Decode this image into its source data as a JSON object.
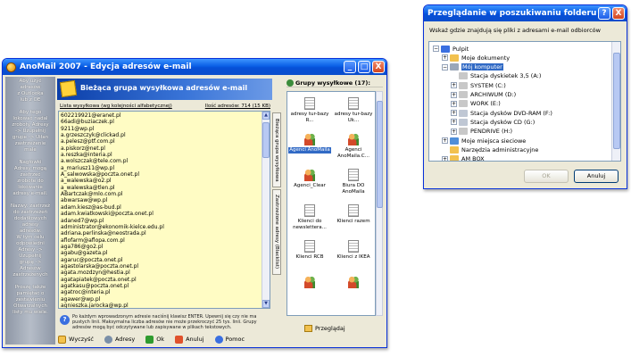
{
  "main_window": {
    "title": "AnoMail 2007 - Edycja adresów e-mail",
    "left_hint": "Aby użyć\nadresów\nz Outlooka\nlub z OE\n\nAby tego\nlokować nadal\nzroboty Adresy\n-> Uzupełnij\ngrupe -> Uiłan\nzastrzeżenie\nmale\n\nNagłówki\nAdresy mogą\nzastrzeć\nzrobote do\nlokowanie\nadresy e-mail.\n\nNazwy: zastrzeż\ndo zastrzeżeń\ndodatkowych\nadresy\nadresów.\nW tym celu\nodpowiedni\nAdresy ->\nUzupełnij\ngrupę ->\nAdresów\nzastrzeżenych\n\nProszę także\npamiętać o\nzestawieniu\nOtwarzalnych\nlisty mu wiele.",
    "header_title": "Bieżąca grupa wysyłkowa adresów e-mail",
    "list_label": "Lista wysyłkowa (wg kolejności alfabetycznej)",
    "count_label": "Ilość adresów: 714 (15 KB)",
    "emails": [
      "602219921@eranet.pl",
      "66adi@buziaczek.pl",
      "9211@wp.pl",
      "a.grzeszczyk@clickad.pl",
      "a.pelesz@ptf.com.pl",
      "a.piskorz@net.pl",
      "a.reszka@interia.pl",
      "a.wolszczak@tele.com.pl",
      "a_mariusz11@wp.pl",
      "A_salwowska@poczta.onet.pl",
      "a_walewska@o2.pl",
      "a_walewska@tlen.pl",
      "ABartczak@mlo.com.pl",
      "abwarsaw@wp.pl",
      "adam.kiesz@as-bud.pl",
      "adam.kwiatkowski@poczta.onet.pl",
      "adaned7@wp.pl",
      "administrator@ekonomik-kielce.edu.pl",
      "adriana.perlinska@neostrada.pl",
      "aflofarm@aflopa.com.pl",
      "aga786@go2.pl",
      "agabu@gazeta.pl",
      "agaruc@poczta.onet.pl",
      "agastolarska@poczta.onet.pl",
      "agata.mozdzyn@hestia.pl",
      "agatapiatek@poczta.onet.pl",
      "agatkasu@poczta.onet.pl",
      "agatroc@interia.pl",
      "agawer@wp.pl",
      "agnieszka.jarocka@wp.pl"
    ],
    "tab_1": "Bieżąca grupa wysyłkowa",
    "tab_2": "Zastrzeżone adresy (Blacklist)",
    "info_text": "Po każdym wprowadzonym adresie naciśnij klawisz ENTER. Upewnij się czy nie ma pustych linii. Maksymalna liczba adresów nie może przekroczyć 25 tys. linii. Grupy adresów mogą być odczytywane lub zapisywane w plikach tekstowych.",
    "buttons": {
      "clear": "Wyczyść",
      "addresses": "Adresy",
      "ok": "Ok",
      "cancel": "Anuluj",
      "help": "Pomoc"
    },
    "groups_title": "Grupy wysyłkowe (17):",
    "groups": [
      "adresy tur-bazy R...",
      "adresy tur-bazy Uk...",
      "Agenci AnoMaila",
      "Agenci AnoMaila.C...",
      "Agenci_Clear",
      "Biura DO AnoMaila",
      "Klienci do newslettera...",
      "Klienci razem",
      "Klienci RCB",
      "Klienci z IKEA",
      "",
      ""
    ],
    "browse_label": "Przeglądaj"
  },
  "folder_dialog": {
    "title": "Przeglądanie w poszukiwaniu folderu",
    "prompt": "Wskaż gdzie znajdują się pliki z adresami e-mail odbiorców",
    "tree": [
      {
        "label": "Pulpit",
        "exp": "−"
      },
      {
        "label": "Moje dokumenty",
        "exp": "+"
      },
      {
        "label": "Mój komputer",
        "exp": "−"
      },
      {
        "label": "Stacja dyskietek 3,5 (A:)",
        "exp": ""
      },
      {
        "label": "SYSTEM (C:)",
        "exp": "+"
      },
      {
        "label": "ARCHIWUM (D:)",
        "exp": "+"
      },
      {
        "label": "WORK (E:)",
        "exp": "+"
      },
      {
        "label": "Stacja dysków DVD-RAM (F:)",
        "exp": "+"
      },
      {
        "label": "Stacja dysków CD (G:)",
        "exp": "+"
      },
      {
        "label": "PENDRIVE (H:)",
        "exp": "+"
      },
      {
        "label": "Moje miejsca sieciowe",
        "exp": "+"
      },
      {
        "label": "Narzędzia administracyjne",
        "exp": ""
      },
      {
        "label": "AM BOX",
        "exp": "+"
      }
    ],
    "ok_label": "OK",
    "cancel_label": "Anuluj",
    "help_glyph": "?",
    "close_glyph": "X"
  },
  "window_glyphs": {
    "minimize": "_",
    "maximize": "□",
    "close": "X"
  },
  "colors": {
    "title_blue": "#0a5fe6",
    "list_bg": "#fffcc4",
    "selection": "#316ac5"
  }
}
